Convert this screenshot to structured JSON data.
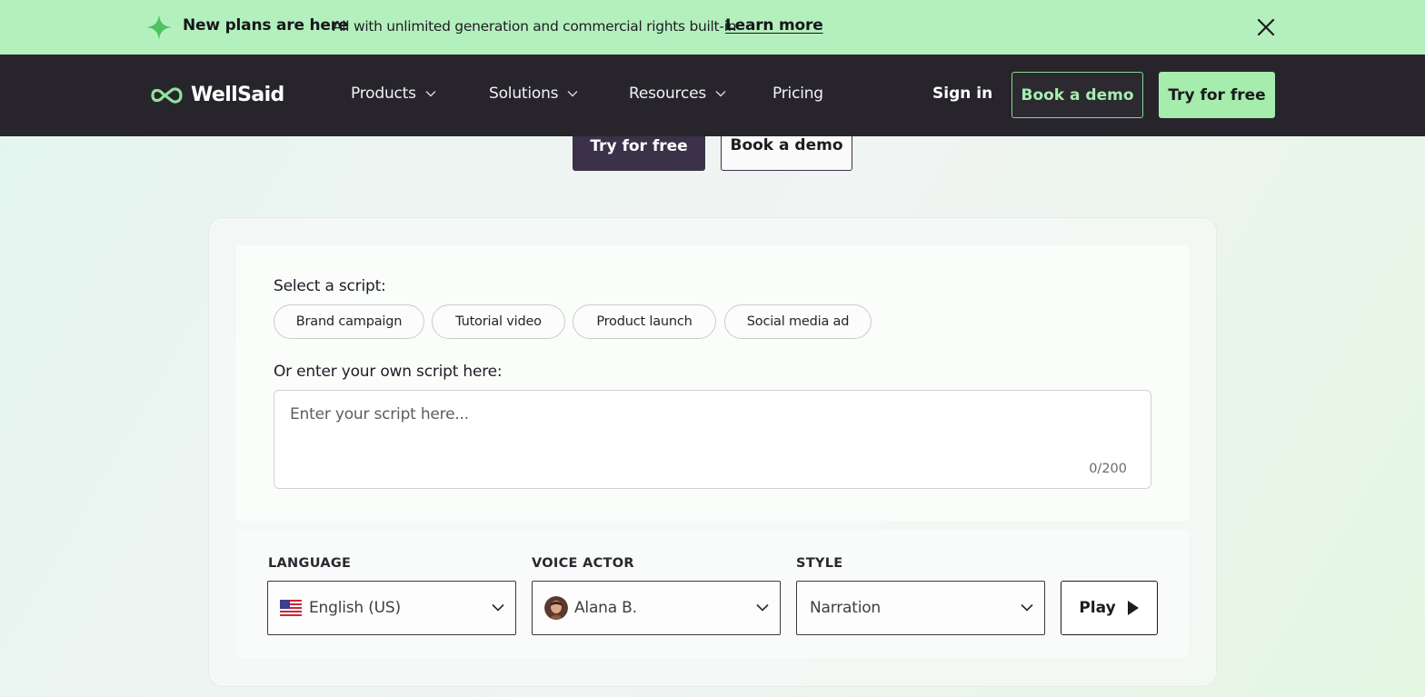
{
  "announcement": {
    "title": "New plans are here",
    "description": "All with unlimited generation and commercial rights built-in",
    "link": "Learn more",
    "accent": "#b4f0bd"
  },
  "nav": {
    "brand": "WellSaid",
    "items": [
      {
        "label": "Products",
        "has_dropdown": true
      },
      {
        "label": "Solutions",
        "has_dropdown": true
      },
      {
        "label": "Resources",
        "has_dropdown": true
      },
      {
        "label": "Pricing",
        "has_dropdown": false
      }
    ],
    "sign_in": "Sign in",
    "book_demo": "Book a demo",
    "try_free": "Try for free",
    "background": "#27252b"
  },
  "hero": {
    "try_free": "Try for free",
    "book_demo": "Book a demo"
  },
  "demo": {
    "select_label": "Select a script:",
    "scripts": [
      "Brand campaign",
      "Tutorial video",
      "Product launch",
      "Social media ad"
    ],
    "own_label": "Or enter your own script here:",
    "placeholder": "Enter your script here...",
    "char_count": "0/200",
    "language_label": "LANGUAGE",
    "language_value": "English (US)",
    "voice_label": "VOICE ACTOR",
    "voice_value": "Alana B.",
    "style_label": "STYLE",
    "style_value": "Narration",
    "play_label": "Play"
  },
  "icons": {
    "announcement": "sparkle-icon",
    "close": "close-icon",
    "logo": "wellsaid-logo-icon",
    "dropdown": "chevron-down-icon",
    "language": "us-flag-icon",
    "voice": "avatar",
    "play": "play-icon"
  }
}
